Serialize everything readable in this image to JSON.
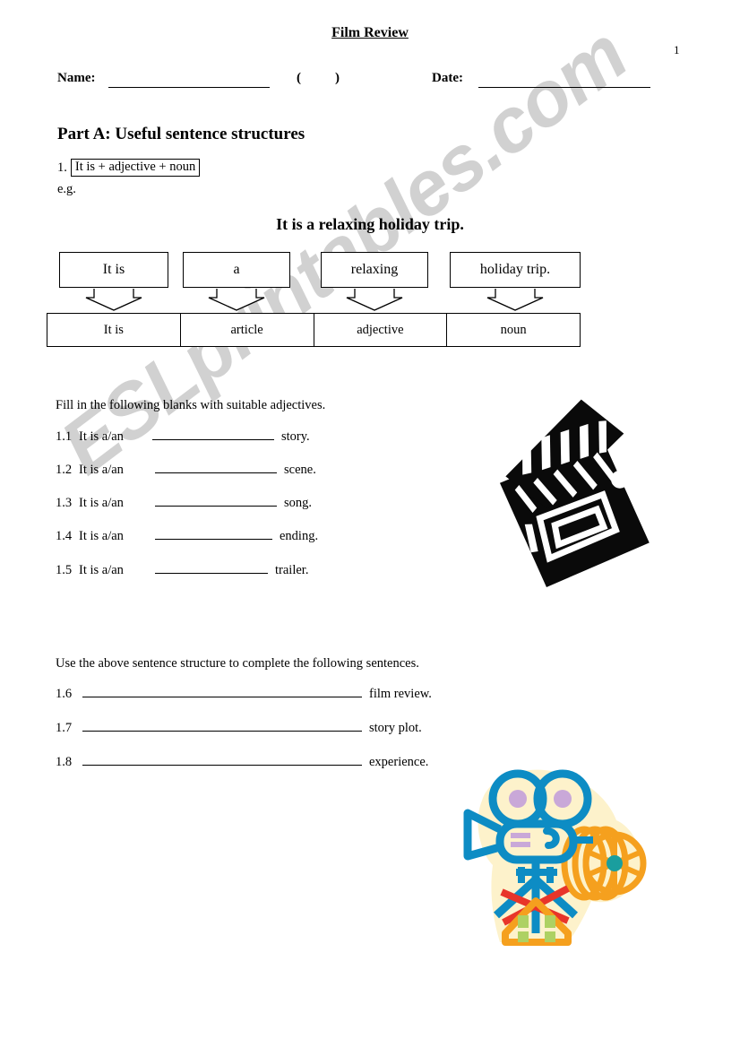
{
  "document": {
    "title": "Film Review",
    "page_number": "1"
  },
  "header": {
    "name_label": "Name:",
    "paren_open": "(",
    "paren_close": ")",
    "date_label": "Date:"
  },
  "part_a": {
    "heading": "Part A: Useful sentence structures",
    "item_number": "1.",
    "structure": "It is + adjective + noun",
    "eg_label": "e.g.",
    "example_sentence": "It is a relaxing holiday trip."
  },
  "diagram": {
    "words": [
      "It is",
      "a",
      "relaxing",
      "holiday trip."
    ],
    "labels": [
      "It is",
      "article",
      "adjective",
      "noun"
    ]
  },
  "exercise_1": {
    "instruction": "Fill in the following blanks with suitable adjectives.",
    "items": [
      {
        "number": "1.1",
        "stem": "It is a/an",
        "tail": "story."
      },
      {
        "number": "1.2",
        "stem": "It is a/an",
        "tail": "scene."
      },
      {
        "number": "1.3",
        "stem": "It is a/an",
        "tail": "song."
      },
      {
        "number": "1.4",
        "stem": "It is a/an",
        "tail": "ending."
      },
      {
        "number": "1.5",
        "stem": "It is a/an",
        "tail": "trailer."
      }
    ]
  },
  "exercise_2": {
    "instruction": "Use the above sentence structure to complete the following sentences.",
    "items": [
      {
        "number": "1.6",
        "tail": "film review."
      },
      {
        "number": "1.7",
        "tail": "story plot."
      },
      {
        "number": "1.8",
        "tail": "experience."
      }
    ]
  },
  "watermark": {
    "text": "ESLprintables.com"
  },
  "illustrations": {
    "clapperboard": "film-clapperboard-icon",
    "movie_camera": "movie-camera-icon"
  },
  "colors": {
    "ink": "#000000",
    "paper": "#ffffff",
    "watermark": "#c9c9c9",
    "camera_blue": "#0d8cc4",
    "camera_cream": "#fdf0c0",
    "camera_orange": "#f5a01e",
    "camera_red": "#e8352a",
    "camera_purple": "#c9a8d8",
    "camera_green": "#aed163",
    "camera_teal": "#1a9e9e"
  }
}
